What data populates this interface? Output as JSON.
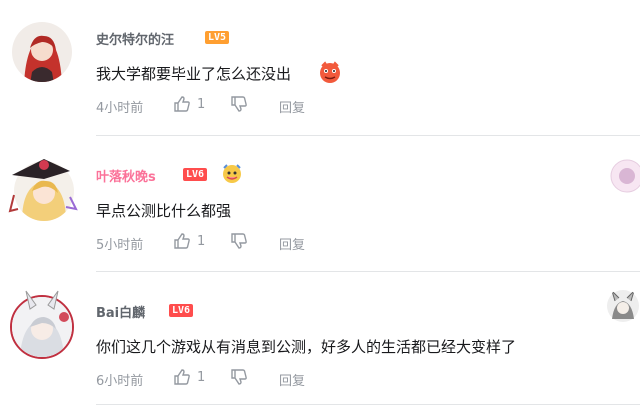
{
  "comments": [
    {
      "username": "史尔特尔的汪",
      "level": "LV5",
      "content": "我大学都要毕业了怎么还没出",
      "time": "4小时前",
      "likes": "1",
      "reply": "回复"
    },
    {
      "username": "叶落秋晚s",
      "level": "LV6",
      "content": "早点公测比什么都强",
      "time": "5小时前",
      "likes": "1",
      "reply": "回复"
    },
    {
      "username": "Bai白麟",
      "level": "LV6",
      "content": "你们这几个游戏从有消息到公测，好多人的生活都已经大变样了",
      "time": "6小时前",
      "likes": "1",
      "reply": "回复"
    }
  ],
  "colors": {
    "username_default": "#61666d",
    "username_vip": "#fb7299",
    "lv5": "#ff9f31",
    "lv6": "#ff4d4d",
    "meta": "#9499a0",
    "content": "#18191c"
  }
}
